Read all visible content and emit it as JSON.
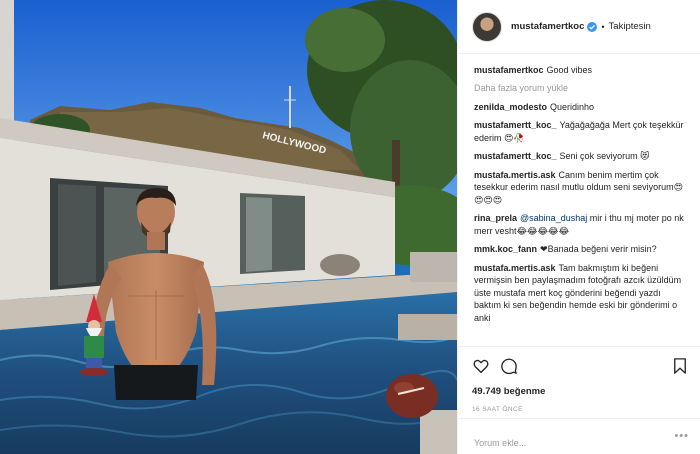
{
  "header": {
    "username": "mustafamertkoc",
    "separator": "•",
    "follow_status": "Takiptesin",
    "verified_icon": "verified-badge-icon",
    "accent": "#3897f0"
  },
  "photo": {
    "description_icon": "pool-photo",
    "sign_text": "HOLLYWOOD"
  },
  "caption": {
    "username": "mustafamertkoc",
    "text": "Good vibes"
  },
  "load_more_label": "Daha fazla yorum yükle",
  "comments": [
    {
      "username": "zenilda_modesto",
      "text": "Queridinho"
    },
    {
      "username": "mustafamertt_koc_",
      "text": "Yağağağağa Mert çok teşekkür ederim 😍🥀"
    },
    {
      "username": "mustafamertt_koc_",
      "text": "Seni çok seviyorum 😻"
    },
    {
      "username": "mustafa.mertis.ask",
      "text": "Canım benim mertim çok tesekkur ederim nasıl mutlu oldum seni seviyorum😍😍😍😍"
    },
    {
      "username": "rina_prela",
      "mention": "@sabina_dushaj",
      "text": "mir i thu mj moter po nk merr vesht😂😂😂😂😂"
    },
    {
      "username": "mmk.koc_fann",
      "text": "❤Banada beğeni verir misin?"
    },
    {
      "username": "mustafa.mertis.ask",
      "text": "Tam bakmıştım ki beğeni vermişsin ben paylaşmadım fotoğrafı azcık üzüldüm üste mustafa mert koç gönderini beğendi yazdı baktım ki sen beğendin hemde eski bir gönderimi o anki"
    }
  ],
  "actions": {
    "like_icon": "heart-icon",
    "comment_icon": "comment-icon",
    "save_icon": "bookmark-icon",
    "likes": "49.749 beğenme",
    "time": "16 SAAT ÖNCE"
  },
  "add_comment": {
    "placeholder": "Yorum ekle...",
    "more_label": "•••"
  }
}
